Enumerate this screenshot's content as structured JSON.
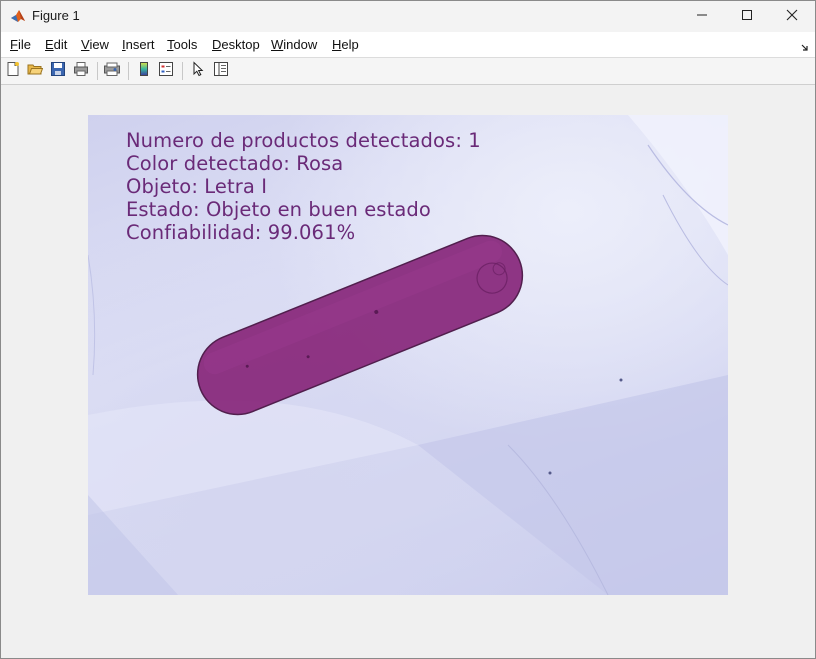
{
  "window": {
    "title": "Figure 1",
    "app_icon": "matlab-logo-icon",
    "controls": [
      "minimize-icon",
      "maximize-icon",
      "close-icon"
    ]
  },
  "menubar": {
    "items": [
      {
        "label": "File",
        "mnemonic": "F",
        "rest": "ile"
      },
      {
        "label": "Edit",
        "mnemonic": "E",
        "rest": "dit"
      },
      {
        "label": "View",
        "mnemonic": "V",
        "rest": "iew"
      },
      {
        "label": "Insert",
        "mnemonic": "I",
        "rest": "nsert"
      },
      {
        "label": "Tools",
        "mnemonic": "T",
        "rest": "ools"
      },
      {
        "label": "Desktop",
        "mnemonic": "D",
        "rest": "esktop"
      },
      {
        "label": "Window",
        "mnemonic": "W",
        "rest": "indow"
      },
      {
        "label": "Help",
        "mnemonic": "H",
        "rest": "elp"
      }
    ]
  },
  "toolbar": {
    "buttons": [
      "new-figure-icon",
      "open-file-icon",
      "save-icon",
      "print-icon",
      "print-preview-icon",
      "colorbar-icon",
      "legend-icon",
      "pointer-icon",
      "property-inspector-icon"
    ]
  },
  "figure": {
    "overlay_text": [
      "Numero de productos detectados: 1",
      "Color detectado: Rosa",
      "Objeto: Letra I",
      "Estado: Objeto en buen estado",
      "Confiabilidad: 99.061%"
    ],
    "text_color": "#6a2a78",
    "object_color": "#8a2c7e",
    "background_tint": "#cfd1ee"
  }
}
